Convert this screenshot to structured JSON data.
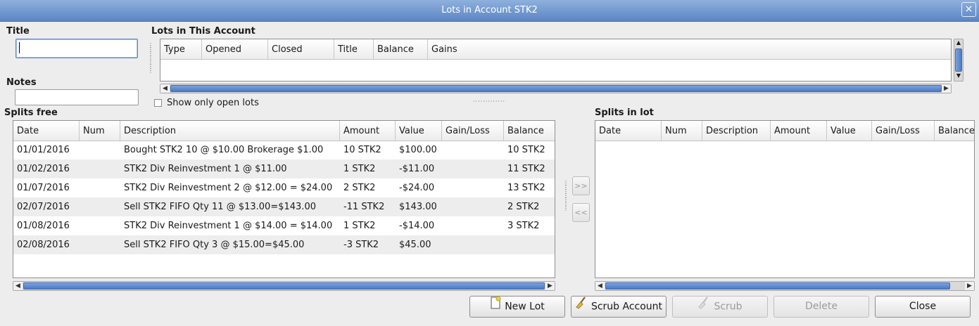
{
  "window": {
    "title": "Lots in Account STK2",
    "close_icon": "×"
  },
  "left": {
    "title_label": "Title",
    "title_value": "",
    "notes_label": "Notes",
    "notes_value": ""
  },
  "lots": {
    "label": "Lots in This Account",
    "columns": [
      "Type",
      "Opened",
      "Closed",
      "Title",
      "Balance",
      "Gains"
    ],
    "show_open_label": "Show only open lots",
    "show_open_checked": false
  },
  "splits_free": {
    "label": "Splits free",
    "columns": [
      "Date",
      "Num",
      "Description",
      "Amount",
      "Value",
      "Gain/Loss",
      "Balance"
    ],
    "rows": [
      [
        "01/01/2016",
        "",
        "Bought STK2 10 @ $10.00 Brokerage $1.00",
        "10 STK2",
        "$100.00",
        "",
        "10 STK2"
      ],
      [
        "01/02/2016",
        "",
        "STK2 Div Reinvestment 1 @ $11.00",
        "1 STK2",
        "-$11.00",
        "",
        "11 STK2"
      ],
      [
        "01/07/2016",
        "",
        "STK2 Div Reinvestment 2 @ $12.00 = $24.00",
        "2 STK2",
        "-$24.00",
        "",
        "13 STK2"
      ],
      [
        "02/07/2016",
        "",
        "Sell STK2 FIFO Qty 11 @ $13.00=$143.00",
        "-11 STK2",
        "$143.00",
        "",
        "2 STK2"
      ],
      [
        "01/08/2016",
        "",
        "STK2 Div Reinvestment 1 @ $14.00 = $14.00",
        "1 STK2",
        "-$14.00",
        "",
        "3 STK2"
      ],
      [
        "02/08/2016",
        "",
        "Sell STK2 FIFO Qty 3 @ $15.00=$45.00",
        "-3 STK2",
        "$45.00",
        "",
        ""
      ]
    ]
  },
  "splits_in_lot": {
    "label": "Splits in lot",
    "columns": [
      "Date",
      "Num",
      "Description",
      "Amount",
      "Value",
      "Gain/Loss",
      "Balance"
    ]
  },
  "move": {
    "add": ">>",
    "remove": "<<"
  },
  "buttons": {
    "new_lot": "New Lot",
    "scrub_account": "Scrub Account",
    "scrub": "Scrub",
    "delete": "Delete",
    "close": "Close"
  },
  "icons": {
    "new_lot": "new-document-icon",
    "scrub_account": "broom-icon",
    "scrub": "broom-icon"
  },
  "colors": {
    "titlebar": "#6b93cc",
    "scroll_thumb": "#5a88cc"
  }
}
